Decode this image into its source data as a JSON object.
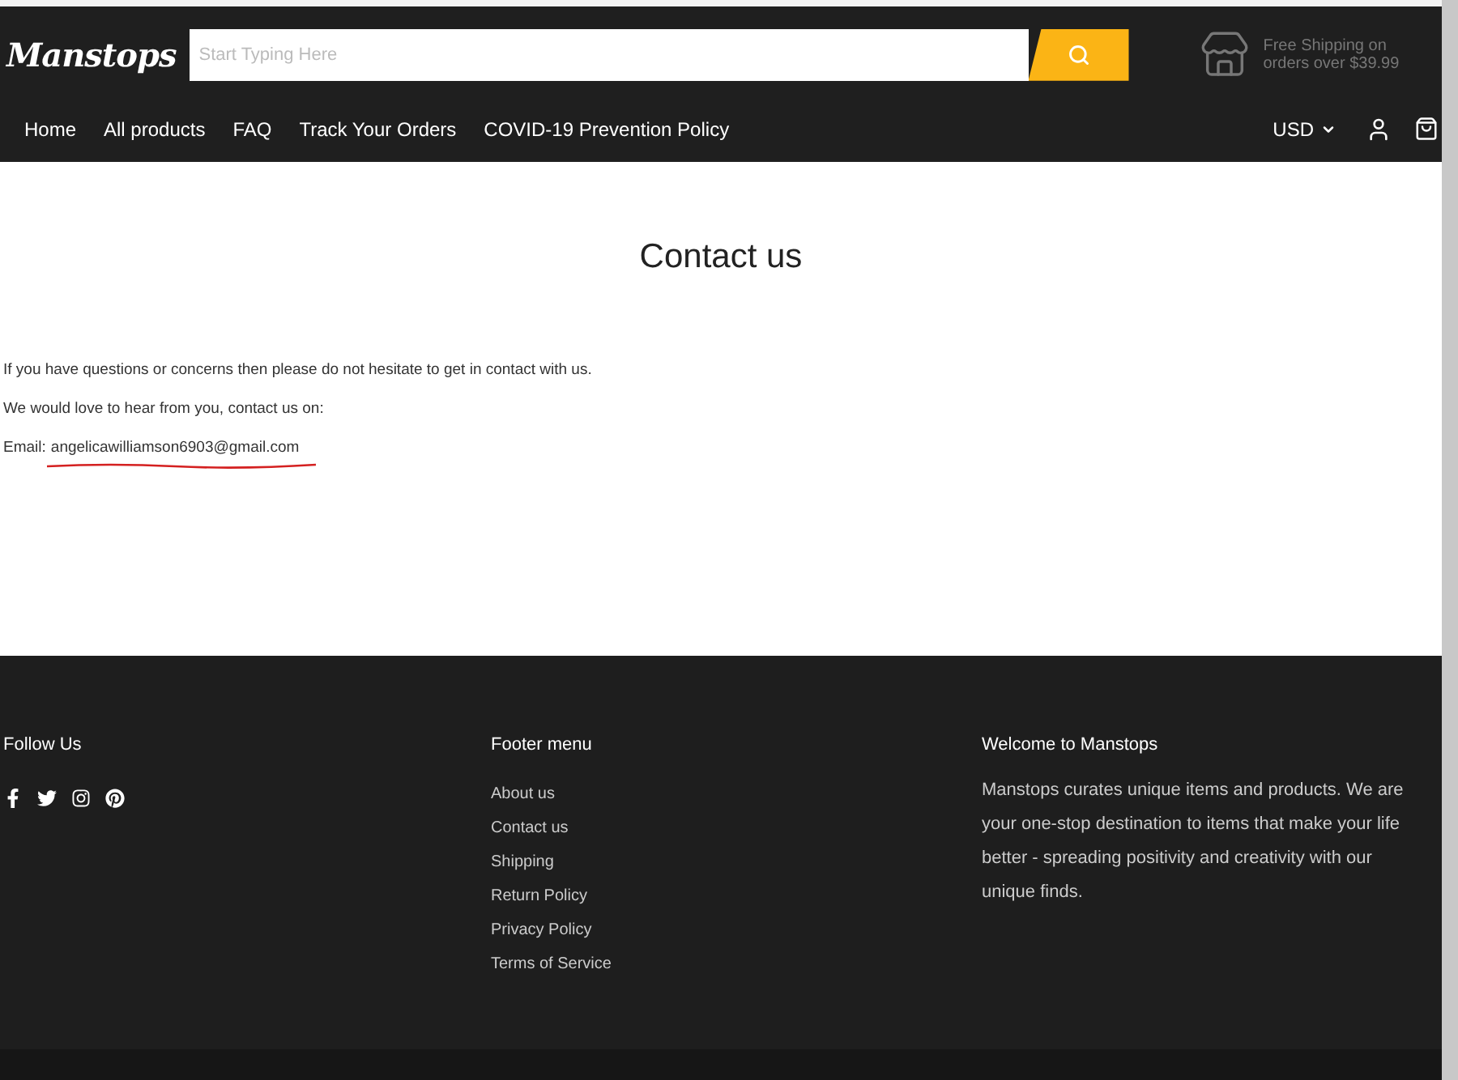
{
  "header": {
    "logo": "Manstops",
    "search": {
      "placeholder": "Start Typing Here"
    },
    "shipping_note": "Free Shipping on orders over $39.99"
  },
  "nav": {
    "items": [
      "Home",
      "All products",
      "FAQ",
      "Track Your Orders",
      "COVID-19 Prevention Policy"
    ],
    "currency": "USD"
  },
  "page": {
    "title": "Contact us",
    "paragraphs": [
      "If you have questions or concerns then please do not hesitate to get in contact with us.",
      "We would love to hear from you, contact us on:"
    ],
    "email_label": "Email:",
    "email": "angelicawilliamson6903@gmail.com",
    "email_underlined": true
  },
  "footer": {
    "follow_title": "Follow Us",
    "socials": [
      {
        "kind": "facebook"
      },
      {
        "kind": "twitter"
      },
      {
        "kind": "instagram"
      },
      {
        "kind": "pinterest"
      }
    ],
    "menu_title": "Footer menu",
    "menu": [
      "About us",
      "Contact us",
      "Shipping",
      "Return Policy",
      "Privacy Policy",
      "Terms of Service"
    ],
    "welcome_title": "Welcome to Manstops",
    "welcome_text": "Manstops curates unique items and products. We are your one-stop destination to items that make your life better - spreading positivity and creativity with our unique finds."
  }
}
